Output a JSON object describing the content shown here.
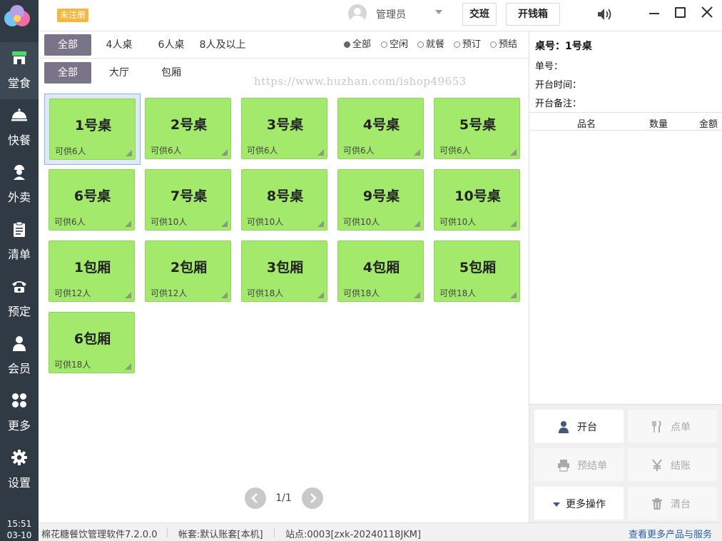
{
  "sidebar": {
    "items": [
      {
        "label": "堂食",
        "icon": "storefront-icon"
      },
      {
        "label": "快餐",
        "icon": "cloche-icon"
      },
      {
        "label": "外卖",
        "icon": "delivery-person-icon"
      },
      {
        "label": "清单",
        "icon": "clipboard-icon"
      },
      {
        "label": "预定",
        "icon": "telephone-icon"
      },
      {
        "label": "会员",
        "icon": "person-icon"
      },
      {
        "label": "更多",
        "icon": "grid-icon"
      },
      {
        "label": "设置",
        "icon": "gear-icon"
      }
    ],
    "clock_time": "15:51",
    "clock_date": "03-10"
  },
  "topbar": {
    "unregistered": "未注册",
    "user_name": "管理员",
    "shift_label": "交班",
    "drawer_label": "开钱箱"
  },
  "filters": {
    "table_types": [
      "全部",
      "4人桌",
      "6人桌",
      "8人及以上"
    ],
    "statuses": [
      "全部",
      "空闲",
      "就餐",
      "预订",
      "预结"
    ],
    "areas": [
      "全部",
      "大厅",
      "包厢"
    ]
  },
  "watermark": "https://www.huzhan.com/ishop49653",
  "tables": [
    {
      "name": "1号桌",
      "capacity": "可供6人"
    },
    {
      "name": "2号桌",
      "capacity": "可供6人"
    },
    {
      "name": "3号桌",
      "capacity": "可供6人"
    },
    {
      "name": "4号桌",
      "capacity": "可供6人"
    },
    {
      "name": "5号桌",
      "capacity": "可供6人"
    },
    {
      "name": "6号桌",
      "capacity": "可供6人"
    },
    {
      "name": "7号桌",
      "capacity": "可供10人"
    },
    {
      "name": "8号桌",
      "capacity": "可供10人"
    },
    {
      "name": "9号桌",
      "capacity": "可供10人"
    },
    {
      "name": "10号桌",
      "capacity": "可供10人"
    },
    {
      "name": "1包厢",
      "capacity": "可供12人"
    },
    {
      "name": "2包厢",
      "capacity": "可供12人"
    },
    {
      "name": "3包厢",
      "capacity": "可供18人"
    },
    {
      "name": "4包厢",
      "capacity": "可供18人"
    },
    {
      "name": "5包厢",
      "capacity": "可供18人"
    },
    {
      "name": "6包厢",
      "capacity": "可供18人"
    }
  ],
  "pagination": {
    "label": "1/1"
  },
  "detail": {
    "table_label": "桌号：1号桌",
    "order_label": "单号：",
    "open_time_label": "开台时间：",
    "note_label": "开台备注：",
    "col_item": "品名",
    "col_qty": "数量",
    "col_amount": "金额"
  },
  "actions": {
    "open": "开台",
    "order": "点单",
    "pre_checkout": "预结单",
    "checkout": "结账",
    "more": "更多操作",
    "clear": "清台"
  },
  "statusbar": {
    "software": "棉花糖餐饮管理软件7.2.0.0",
    "account": "帐套:默认账套[本机]",
    "station": "站点:0003[zxk-20240118JKM]",
    "more_link": "查看更多产品与服务"
  },
  "colors": {
    "nav_bg": "#2f3a44",
    "tab_selected": "#7a7488",
    "table_card": "#a3e96c",
    "badge": "#f7b63f"
  }
}
